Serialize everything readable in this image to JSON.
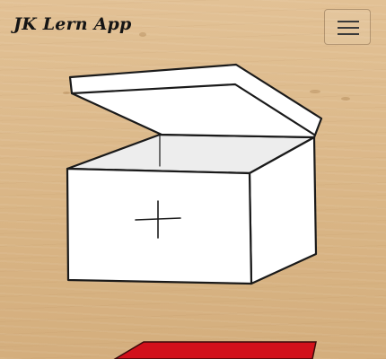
{
  "header": {
    "brand_title": "JK Lern App",
    "menu_icon": "hamburger-menu-icon"
  },
  "illustrations": {
    "main_box_icon": "open-box-plus-icon",
    "red_box_icon": "red-box-icon"
  },
  "colors": {
    "box_fill": "#ffffff",
    "outline": "#1a1a1a",
    "red_box": "#d2101b",
    "wood": "#dcb98b"
  }
}
